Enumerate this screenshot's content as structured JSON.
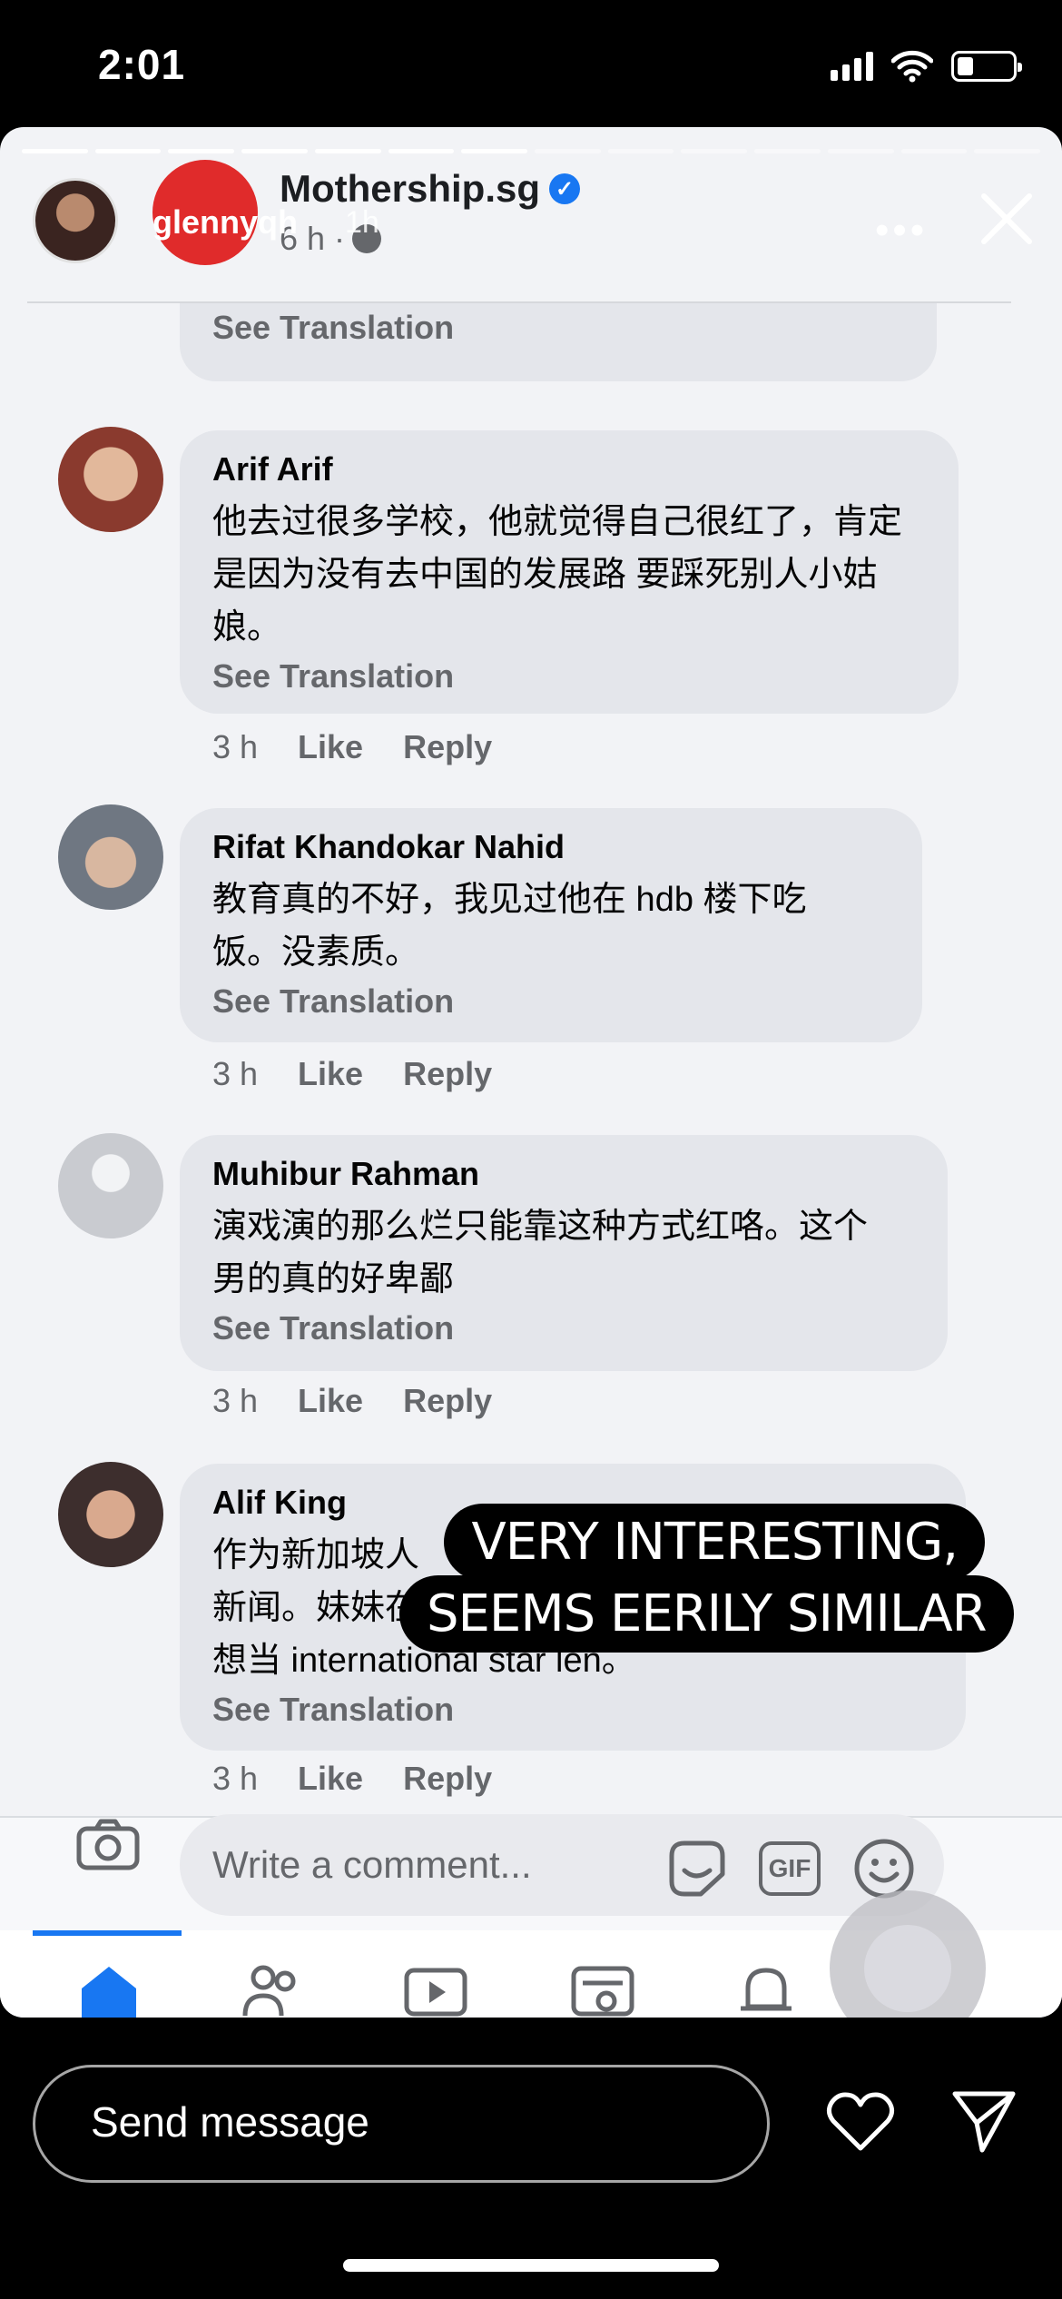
{
  "status_bar": {
    "time": "2:01",
    "battery_level": 0.3
  },
  "story": {
    "progress_segments": 14,
    "progress_completed": 7,
    "user": {
      "name": "glennyqh",
      "time": "1h"
    }
  },
  "post": {
    "page_name": "Mothership.sg",
    "meta": "6 h ·"
  },
  "comment_actions": {
    "time": "3 h",
    "like": "Like",
    "reply": "Reply"
  },
  "top_stub_text": "See Translation",
  "comments": [
    {
      "name": "Arif Arif",
      "lines": [
        "他去过很多学校，他就觉得自己很红了，肯定",
        "是因为没有去中国的发展路 要踩死别人小姑",
        "娘。"
      ],
      "see_translation": "See Translation"
    },
    {
      "name": "Rifat Khandokar Nahid",
      "lines": [
        "教育真的不好，我见过他在 hdb 楼下吃",
        "饭。没素质。"
      ],
      "see_translation": "See Translation"
    },
    {
      "name": "Muhibur Rahman",
      "lines": [
        "演戏演的那么烂只能靠这种方式红咯。这个",
        "男的真的好卑鄙"
      ],
      "see_translation": "See Translation"
    },
    {
      "name": "Alif King",
      "lines": [
        "作为新加坡人",
        "新闻。妹妹在",
        "想当 international star len。"
      ],
      "see_translation": "See Translation"
    }
  ],
  "comment_input": {
    "placeholder": "Write a comment...",
    "gif_label": "GIF"
  },
  "overlay_caption": {
    "line1": "VERY INTERESTING,",
    "line2": "SEEMS EERILY SIMILAR"
  },
  "reply_bar": {
    "placeholder": "Send message"
  }
}
